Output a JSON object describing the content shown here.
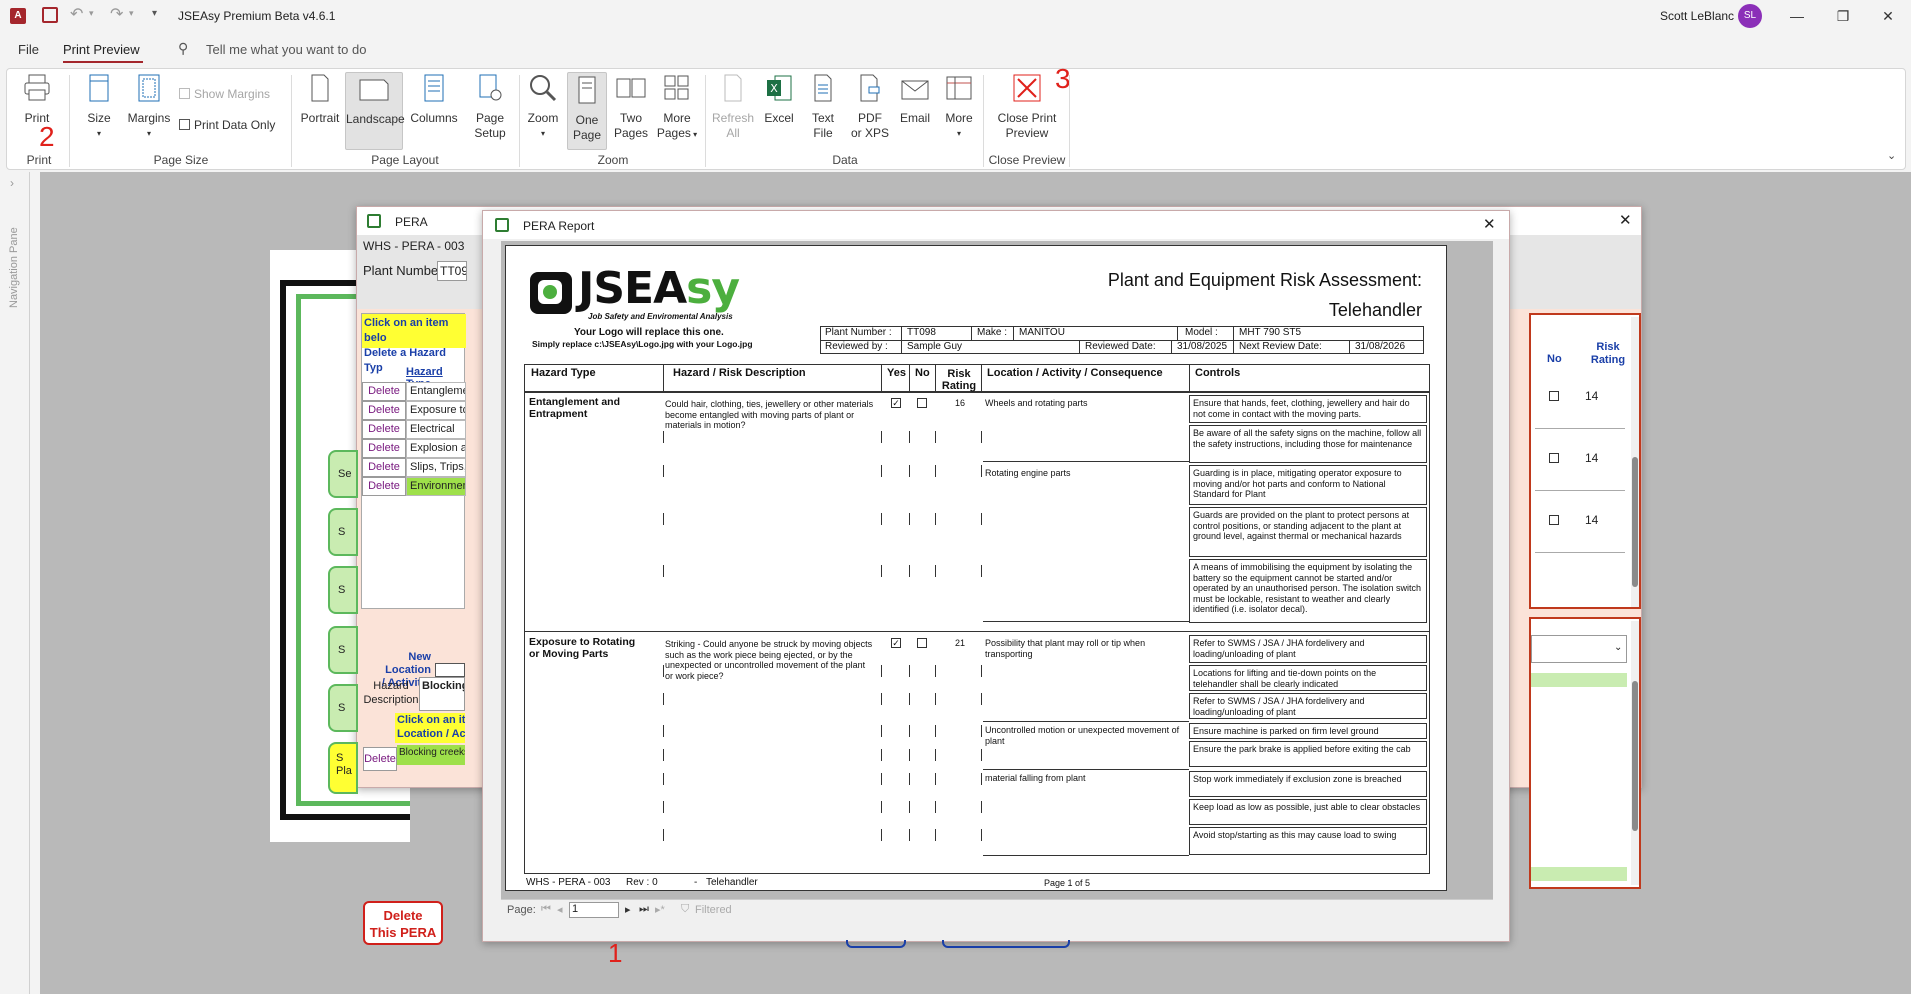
{
  "app": {
    "title": "JSEAsy Premium Beta v4.6.1",
    "user_name": "Scott LeBlanc",
    "user_initials": "SL",
    "accent_color": "#a4262c"
  },
  "menu": {
    "tabs": [
      "File",
      "Print Preview"
    ],
    "active_tab": "Print Preview",
    "tell_me": "Tell me what you want to do"
  },
  "ribbon": {
    "print": {
      "label": "Print",
      "group": "Print"
    },
    "page_size": {
      "group": "Page Size",
      "size": "Size",
      "margins": "Margins",
      "show_margins": "Show Margins",
      "print_data_only": "Print Data Only"
    },
    "page_layout": {
      "group": "Page Layout",
      "portrait": "Portrait",
      "landscape": "Landscape",
      "columns": "Columns",
      "page_setup_1": "Page",
      "page_setup_2": "Setup"
    },
    "zoom": {
      "group": "Zoom",
      "zoom": "Zoom",
      "one_page_1": "One",
      "one_page_2": "Page",
      "two_pages_1": "Two",
      "two_pages_2": "Pages",
      "more_pages_1": "More",
      "more_pages_2": "Pages"
    },
    "data": {
      "group": "Data",
      "refresh_1": "Refresh",
      "refresh_2": "All",
      "excel": "Excel",
      "text_1": "Text",
      "text_2": "File",
      "pdf_1": "PDF",
      "pdf_2": "or XPS",
      "email": "Email",
      "more": "More"
    },
    "close": {
      "group": "Close Preview",
      "label_1": "Close Print",
      "label_2": "Preview"
    }
  },
  "annotations": {
    "one": "1",
    "two": "2",
    "three": "3"
  },
  "nav_pane": {
    "label": "Navigation Pane"
  },
  "pera_window": {
    "title": "PERA",
    "record_id": "WHS - PERA - 003",
    "plant_number_label": "Plant Number",
    "plant_number_value": "TT09",
    "instruction_1": "Click on an item belo",
    "instruction_2": "Delete a Hazard Typ",
    "hazard_type_header": "Hazard Type",
    "delete_label": "Delete",
    "hazard_rows": [
      "Entanglement a",
      "Exposure to Ro",
      "Electrical",
      "Explosion and F",
      "Slips, Trips, Fal",
      "Environmental"
    ],
    "new_location_1": "New Location",
    "new_location_2": "/ Activity:",
    "hazard_desc_1": "Hazard",
    "hazard_desc_2": "Description",
    "hazard_desc_value": "Blocking",
    "click_item_1": "Click on an ite",
    "click_item_2": "Location / Acti",
    "location_row": "Blocking creeks",
    "delete_pera_1": "Delete",
    "delete_pera_2": "This PERA",
    "right_no": "No",
    "right_risk_1": "Risk",
    "right_risk_2": "Rating",
    "right_ratings": [
      "14",
      "14",
      "14"
    ],
    "side_button_partial": [
      "Se",
      "S",
      "S",
      "S",
      "S",
      "S"
    ],
    "side_button_yellow": "Pla"
  },
  "report_window": {
    "title": "PERA Report",
    "page_label": "Page:",
    "page_value": "1",
    "filter_label": "Filtered"
  },
  "report": {
    "logo_text": "JSEAsy",
    "logo_subtitle": "Job Safety and Enviromental Analysis",
    "logo_note_1": "Your Logo will replace this one.",
    "logo_note_2": "Simply replace c:\\JSEAsy\\Logo.jpg with your Logo.jpg",
    "title_1": "Plant and Equipment Risk Assessment:",
    "title_2": "Telehandler",
    "info": {
      "plant_number_label": "Plant Number :",
      "plant_number": "TT098",
      "make_label": "Make :",
      "make": "MANITOU",
      "model_label": "Model :",
      "model": "MHT 790 ST5",
      "reviewed_by_label": "Reviewed by :",
      "reviewed_by": "Sample Guy",
      "reviewed_date_label": "Reviewed Date:",
      "reviewed_date": "31/08/2025",
      "next_review_label": "Next Review Date:",
      "next_review": "31/08/2026"
    },
    "columns": {
      "hazard_type": "Hazard Type",
      "description": "Hazard / Risk Description",
      "yes": "Yes",
      "no": "No",
      "risk_1": "Risk",
      "risk_2": "Rating",
      "location": "Location / Activity / Consequence",
      "controls": "Controls"
    },
    "section1": {
      "hazard_1": "Entanglement and",
      "hazard_2": "Entrapment",
      "description": "Could hair, clothing, ties, jewellery or other materials become entangled with moving parts of plant or materials in motion?",
      "rating": "16",
      "location_1": "Wheels and rotating parts",
      "location_2": "Rotating engine parts",
      "controls": [
        "Ensure that hands, feet, clothing, jewellery and hair do not come in contact with the moving parts.",
        "Be aware of all the safety signs on the machine, follow all the safety instructions, including those for maintenance",
        "Guarding is in place, mitigating operator exposure to moving and/or hot parts and conform to National Standard for Plant",
        "Guards are provided on the plant to protect persons at control positions, or standing adjacent to the plant at ground level, against thermal or mechanical hazards",
        "A means of immobilising the equipment by isolating the battery so the equipment cannot be started and/or operated by an unauthorised person. The isolation switch must be lockable, resistant to weather and clearly identified (i.e. isolator decal)."
      ]
    },
    "section2": {
      "hazard_1": "Exposure to Rotating",
      "hazard_2": "or Moving Parts",
      "description": "Striking - Could anyone be struck by moving objects such as the work piece being ejected, or by the unexpected or uncontrolled movement of the plant or work piece?",
      "rating": "21",
      "location_1": "Possibility that plant may roll or tip when transporting",
      "location_2": "Uncontrolled motion or unexpected movement of plant",
      "location_3": "material falling from plant",
      "controls": [
        "Refer to SWMS / JSA / JHA fordelivery and loading/unloading of plant",
        "Locations for lifting and tie-down points on the telehandler shall be clearly indicated",
        "Refer to SWMS / JSA / JHA fordelivery and loading/unloading of plant",
        "Ensure machine is parked on firm level ground",
        "Ensure the park brake is applied before exiting the cab",
        "Stop work immediately if exclusion zone is breached",
        "Keep load as low as possible, just able to clear obstacles",
        "Avoid stop/starting as this may cause load to swing"
      ]
    },
    "footer": {
      "record": "WHS - PERA - 003",
      "rev": "Rev : 0",
      "dash": "-",
      "name": "Telehandler",
      "page": "Page 1 of 5"
    }
  }
}
